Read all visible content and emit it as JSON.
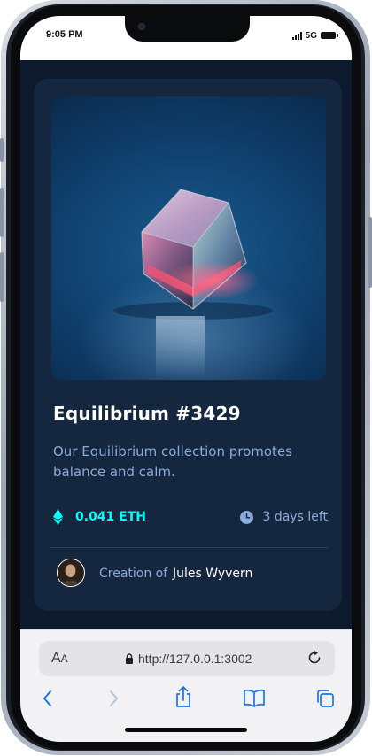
{
  "status_bar": {
    "time": "9:05 PM",
    "network": "5G",
    "icons": [
      "signal-bars-icon",
      "battery-icon"
    ]
  },
  "card": {
    "image": {
      "alt_semantic": "glowing glass cube on blue background"
    },
    "title": "Equilibrium #3429",
    "description": "Our Equilibrium collection promotes balance and calm.",
    "price": "0.041 ETH",
    "time_left": "3 days left",
    "creator_prefix": "Creation of",
    "creator_name": "Jules Wyvern",
    "icons": [
      "ethereum-icon",
      "clock-icon",
      "avatar"
    ]
  },
  "browser": {
    "text_size_button_big": "A",
    "text_size_button_small": "A",
    "url": "http://127.0.0.1:3002",
    "toolbar_icons": [
      "back-icon",
      "forward-icon",
      "share-icon",
      "bookmarks-icon",
      "tabs-icon"
    ]
  },
  "colors": {
    "page_bg": "#0d192c",
    "card_bg": "#15263f",
    "accent_cyan": "#00fff8",
    "soft_blue": "#8bacd9",
    "ios_blue": "#1a74e8"
  }
}
